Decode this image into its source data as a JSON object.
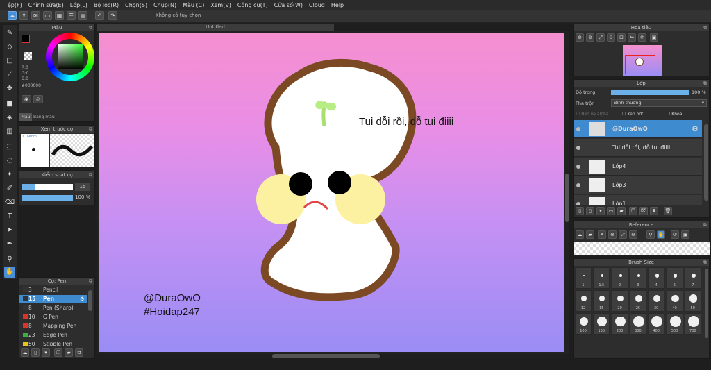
{
  "menu": [
    "Tệp(F)",
    "Chỉnh sửa(E)",
    "Lớp(L)",
    "Bộ lọc(R)",
    "Chọn(S)",
    "Chụp(N)",
    "Màu (C)",
    "Xem(V)",
    "Công cụ(T)",
    "Cửa sổ(W)",
    "Cloud",
    "Help"
  ],
  "toolbar_hint": "Không có tùy chọn",
  "document_title": "Untitled",
  "color_panel": {
    "title": "Màu",
    "r": "R:0",
    "g": "G:0",
    "b": "B:0",
    "hex": "#000000",
    "tab_color": "Màu",
    "tab_palette": "Bảng màu"
  },
  "brush_preview": {
    "title": "Xem trước cọ",
    "size": "1.09mm"
  },
  "brush_control": {
    "title": "Kiểm soát cọ",
    "size": "15",
    "opacity": "100 %"
  },
  "brush_list": {
    "title": "Cọ: Pen",
    "items": [
      {
        "size": "3",
        "name": "Pencil",
        "color": "#333333"
      },
      {
        "size": "15",
        "name": "Pen",
        "color": "#333333"
      },
      {
        "size": "8",
        "name": "Pen (Sharp)",
        "color": "#333333"
      },
      {
        "size": "10",
        "name": "G Pen",
        "color": "#d9342b"
      },
      {
        "size": "8",
        "name": "Mapping Pen",
        "color": "#d9342b"
      },
      {
        "size": "23",
        "name": "Edge Pen",
        "color": "#3cb043"
      },
      {
        "size": "50",
        "name": "Stipple Pen",
        "color": "#e6c619"
      }
    ]
  },
  "canvas_text": {
    "caption": "Tui dỗi rồi, dỗ tui điiii",
    "signature1": "@DuraOwO",
    "signature2": "#Hoidap247"
  },
  "navigator": {
    "title": "Hoa tiêu"
  },
  "layers": {
    "title": "Lớp",
    "opacity_label": "Độ trong",
    "opacity_value": "100 %",
    "blend_label": "Pha trộn",
    "blend_value": "Bình thường",
    "protect_alpha": "Bảo vệ alpha",
    "clipping": "Xén bớt",
    "lock": "Khóa",
    "items": [
      "@DuraOwO",
      "Tui dỗi rồi, dỗ tui điiii",
      "Lớp4",
      "Lớp3",
      "Lớp1"
    ]
  },
  "reference": {
    "title": "Reference"
  },
  "brush_size": {
    "title": "Brush Size",
    "sizes": [
      "1",
      "1.5",
      "2",
      "3",
      "4",
      "5",
      "7",
      "12",
      "15",
      "20",
      "25",
      "30",
      "40",
      "50",
      "100",
      "150",
      "200",
      "300",
      "400",
      "500",
      "700"
    ]
  }
}
